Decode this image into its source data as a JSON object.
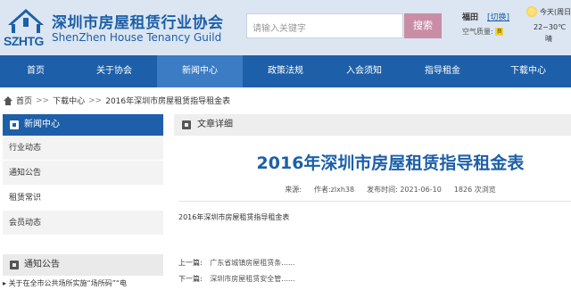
{
  "header": {
    "logo_cn": "深圳市房屋租赁行业协会",
    "logo_en": "ShenZhen House Tenancy Guild",
    "logo_mark_text": "SZHTG",
    "search_placeholder": "请输入关键字",
    "search_button": "搜索",
    "city": "福田",
    "city_switch": "[切换]",
    "air_label": "空气质量:",
    "air_value": "良",
    "weather_today": "今天(周日)",
    "weather_temp": "22~30℃",
    "weather_desc": "晴",
    "weather_icon": "sun-icon"
  },
  "nav": {
    "items": [
      {
        "label": "首页"
      },
      {
        "label": "关于协会"
      },
      {
        "label": "新闻中心"
      },
      {
        "label": "政策法规"
      },
      {
        "label": "入会须知"
      },
      {
        "label": "指导租金"
      },
      {
        "label": "下载中心"
      }
    ],
    "active_index": 2
  },
  "breadcrumb": {
    "home": "首页",
    "sep": ">>",
    "section": "下载中心",
    "current": "2016年深圳市房屋租赁指导租金表"
  },
  "sidebar": {
    "title": "新闻中心",
    "items": [
      {
        "label": "行业动态"
      },
      {
        "label": "通知公告"
      },
      {
        "label": "租赁常识"
      },
      {
        "label": "会员动态"
      }
    ],
    "notice_title": "通知公告",
    "notice_item": "关于在全市公共场所实施“场所码”“电"
  },
  "article": {
    "section_title": "文章详细",
    "title": "2016年深圳市房屋租赁指导租金表",
    "source": "来源:",
    "author": "作者:zlxh38",
    "date": "发布时间: 2021-06-10",
    "views": "1826 次浏览",
    "body": "2016年深圳市房屋租赁指导租金表",
    "prev_label": "上一篇:",
    "prev_link": "广东省城镇房屋租赁条......",
    "next_label": "下一篇:",
    "next_link": "深圳市房屋租赁安全管......"
  },
  "colors": {
    "brand": "#1d5fa8",
    "nav_active": "#3b7cc4",
    "search_button": "#c98ea5"
  }
}
